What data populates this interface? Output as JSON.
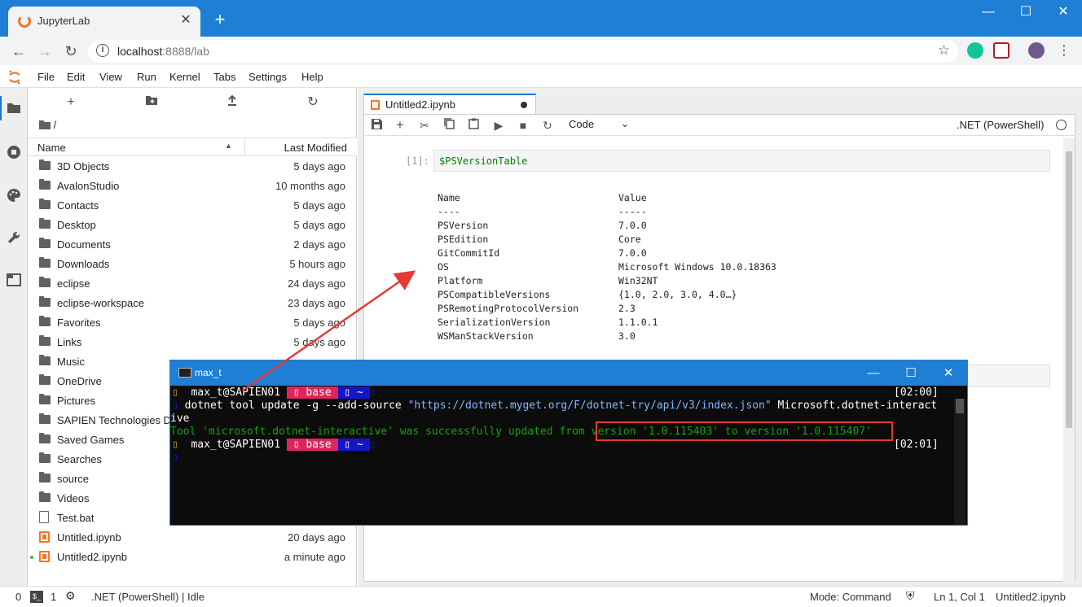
{
  "browser": {
    "tab_title": "JupyterLab",
    "url_host": "localhost",
    "url_rest": ":8888/lab"
  },
  "menu": [
    "File",
    "Edit",
    "View",
    "Run",
    "Kernel",
    "Tabs",
    "Settings",
    "Help"
  ],
  "filebrowser": {
    "breadcrumb": "/",
    "col_name": "Name",
    "col_modified": "Last Modified",
    "files": [
      {
        "name": "3D Objects",
        "date": "5 days ago",
        "kind": "folder"
      },
      {
        "name": "AvalonStudio",
        "date": "10 months ago",
        "kind": "folder"
      },
      {
        "name": "Contacts",
        "date": "5 days ago",
        "kind": "folder"
      },
      {
        "name": "Desktop",
        "date": "5 days ago",
        "kind": "folder"
      },
      {
        "name": "Documents",
        "date": "2 days ago",
        "kind": "folder"
      },
      {
        "name": "Downloads",
        "date": "5 hours ago",
        "kind": "folder"
      },
      {
        "name": "eclipse",
        "date": "24 days ago",
        "kind": "folder"
      },
      {
        "name": "eclipse-workspace",
        "date": "23 days ago",
        "kind": "folder"
      },
      {
        "name": "Favorites",
        "date": "5 days ago",
        "kind": "folder"
      },
      {
        "name": "Links",
        "date": "5 days ago",
        "kind": "folder"
      },
      {
        "name": "Music",
        "date": "",
        "kind": "folder"
      },
      {
        "name": "OneDrive",
        "date": "",
        "kind": "folder"
      },
      {
        "name": "Pictures",
        "date": "",
        "kind": "folder"
      },
      {
        "name": "SAPIEN Technologies Dr",
        "date": "",
        "kind": "folder"
      },
      {
        "name": "Saved Games",
        "date": "",
        "kind": "folder"
      },
      {
        "name": "Searches",
        "date": "",
        "kind": "folder"
      },
      {
        "name": "source",
        "date": "",
        "kind": "folder"
      },
      {
        "name": "Videos",
        "date": "",
        "kind": "folder"
      },
      {
        "name": "Test.bat",
        "date": "",
        "kind": "file"
      },
      {
        "name": "Untitled.ipynb",
        "date": "20 days ago",
        "kind": "notebook"
      },
      {
        "name": "Untitled2.ipynb",
        "date": "a minute ago",
        "kind": "notebook",
        "running": true
      }
    ]
  },
  "notebook": {
    "tab_title": "Untitled2.ipynb",
    "cell_type": "Code",
    "kernel": ".NET (PowerShell)",
    "prompt": "[1]:",
    "code": "$PSVersionTable",
    "output": {
      "headers": [
        "Name",
        "Value"
      ],
      "dashes": [
        "----",
        "-----"
      ],
      "rows": [
        [
          "PSVersion",
          "7.0.0"
        ],
        [
          "PSEdition",
          "Core"
        ],
        [
          "GitCommitId",
          "7.0.0"
        ],
        [
          "OS",
          "Microsoft Windows 10.0.18363"
        ],
        [
          "Platform",
          "Win32NT"
        ],
        [
          "PSCompatibleVersions",
          "{1.0, 2.0, 3.0, 4.0…}"
        ],
        [
          "PSRemotingProtocolVersion",
          "2.3"
        ],
        [
          "SerializationVersion",
          "1.1.0.1"
        ],
        [
          "WSManStackVersion",
          "3.0"
        ]
      ]
    }
  },
  "statusbar": {
    "count0": "0",
    "count1": "1",
    "kernel_status": ".NET (PowerShell) | Idle",
    "mode": "Mode: Command",
    "position": "Ln 1, Col 1",
    "filename": "Untitled2.ipynb"
  },
  "terminal": {
    "title": "max_t",
    "prompt_user": "max_t@SAPIEN01",
    "env": "base",
    "dir": "~",
    "time1": "[02:00]",
    "time2": "[02:01]",
    "cmd_pre": "dotnet tool update -g --add-source ",
    "cmd_url": "\"https://dotnet.myget.org/F/dotnet-try/api/v3/index.json\"",
    "cmd_post": " Microsoft.dotnet-interact",
    "cmd_wrap": "ive",
    "result_pre": "Tool 'microsoft.dotnet-interactive' was successfully updated from ",
    "result_highlight": "version '1.0.115403' to version '1.0.115407'"
  }
}
